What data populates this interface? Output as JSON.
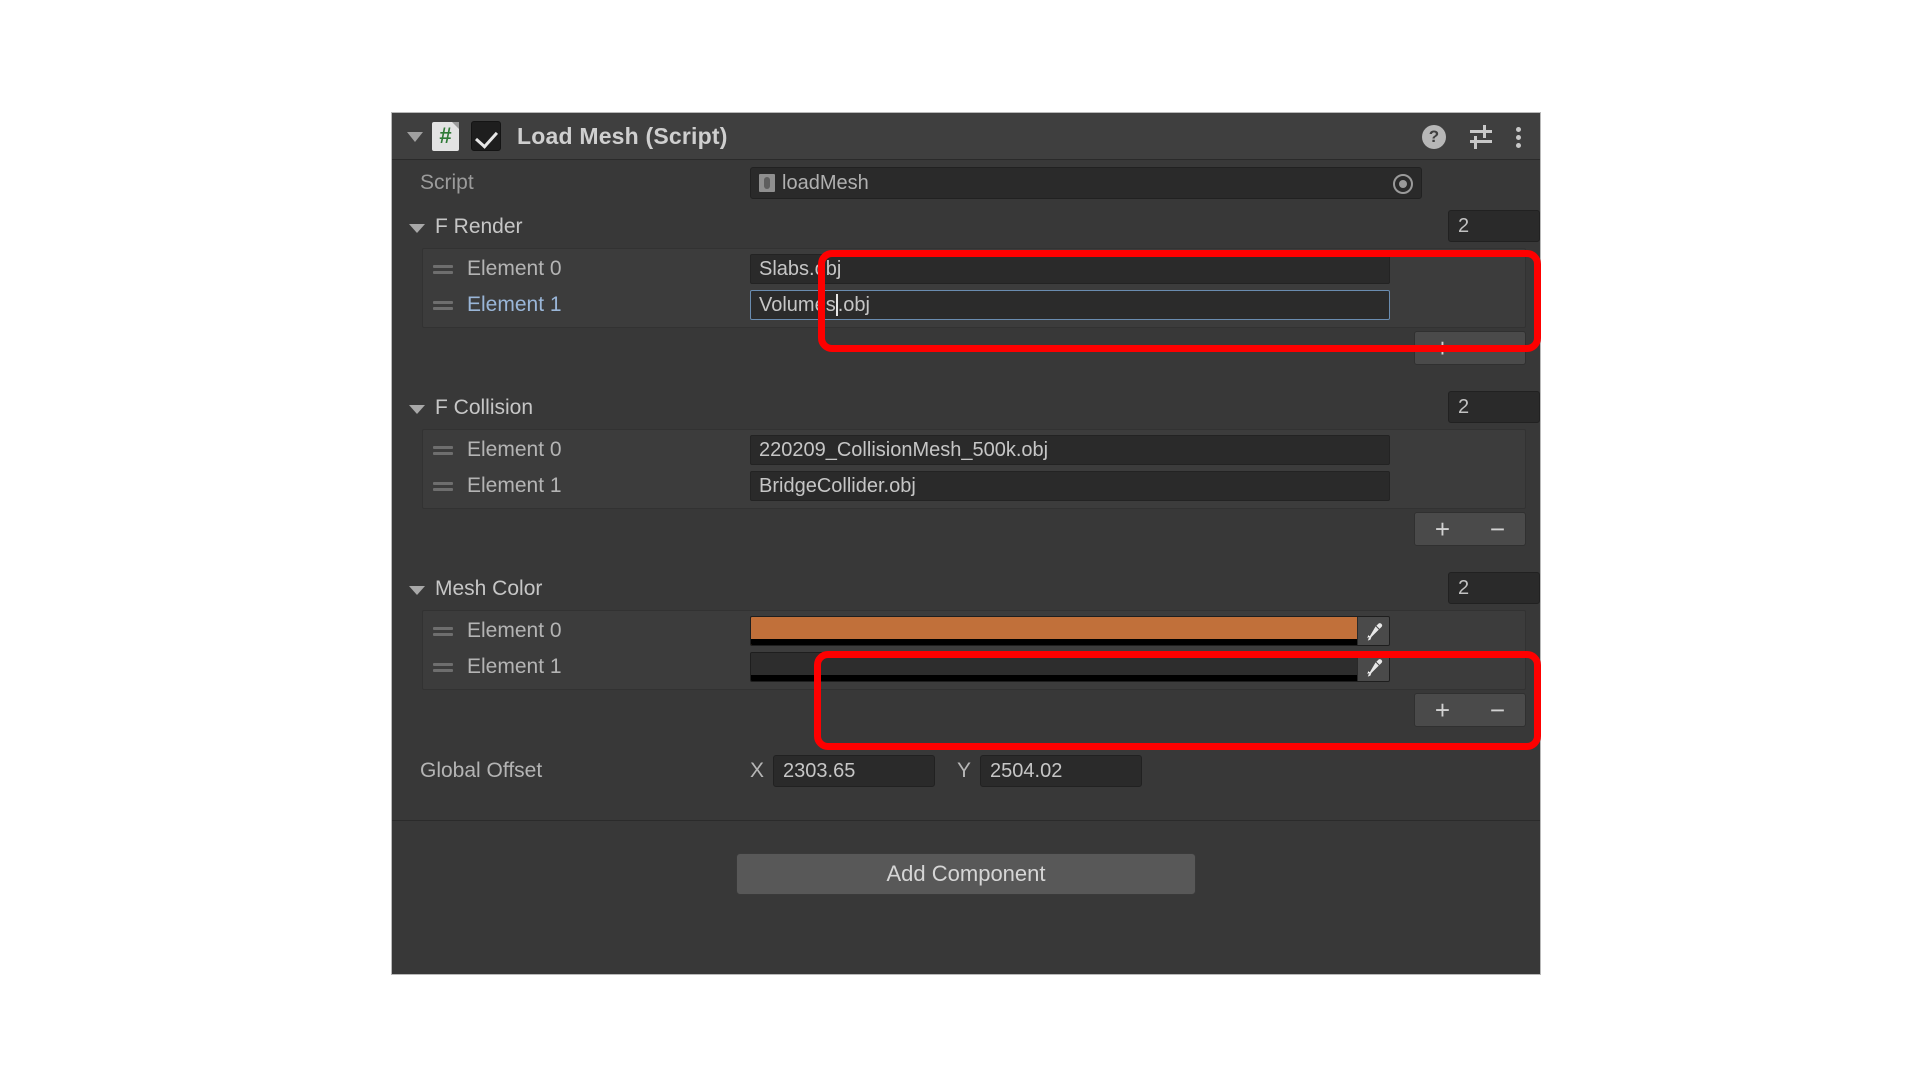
{
  "component": {
    "title": "Load Mesh (Script)",
    "enabled": true,
    "foldout_expanded": true,
    "icons": {
      "foldout": "triangle-down-icon",
      "script": "csharp-script-icon",
      "enabled_checkbox": "checkbox-checked-icon",
      "help": "?",
      "preset": "preset-sliders-icon",
      "menu": "kebab-menu-icon"
    }
  },
  "script_row": {
    "label": "Script",
    "value": "loadMesh",
    "picker_icon": "object-picker-icon"
  },
  "arrays": [
    {
      "name": "F Render",
      "size": "2",
      "expanded": true,
      "type": "text",
      "elements": [
        {
          "label": "Element 0",
          "value": "Slabs.obj",
          "focused": false,
          "selected": false
        },
        {
          "label": "Element 1",
          "value": "Volumes",
          "value_tail": ".obj",
          "focused": true,
          "selected": true
        }
      ],
      "add_label": "+",
      "remove_label": "−",
      "highlighted": true
    },
    {
      "name": "F Collision",
      "size": "2",
      "expanded": true,
      "type": "text",
      "elements": [
        {
          "label": "Element 0",
          "value": "220209_CollisionMesh_500k.obj",
          "focused": false,
          "selected": false
        },
        {
          "label": "Element 1",
          "value": "BridgeCollider.obj",
          "focused": false,
          "selected": false
        }
      ],
      "add_label": "+",
      "remove_label": "−",
      "highlighted": false
    },
    {
      "name": "Mesh Color",
      "size": "2",
      "expanded": true,
      "type": "color",
      "elements": [
        {
          "label": "Element 0",
          "color": "#c1703a",
          "alpha_color": "#000000",
          "eyedropper_icon": "eyedropper-icon"
        },
        {
          "label": "Element 1",
          "color": "#2d2d2d",
          "alpha_color": "#000000",
          "eyedropper_icon": "eyedropper-icon"
        }
      ],
      "add_label": "+",
      "remove_label": "−",
      "highlighted": true
    }
  ],
  "global_offset": {
    "label": "Global Offset",
    "x_axis": "X",
    "x_value": "2303.65",
    "y_axis": "Y",
    "y_value": "2504.02"
  },
  "footer": {
    "add_component_label": "Add Component"
  },
  "annotations": {
    "color": "#fe0000",
    "count": 2,
    "notes": [
      "Red rounded rectangle highlighting F Render element value fields",
      "Red rounded rectangle highlighting Mesh Color element color fields"
    ]
  }
}
